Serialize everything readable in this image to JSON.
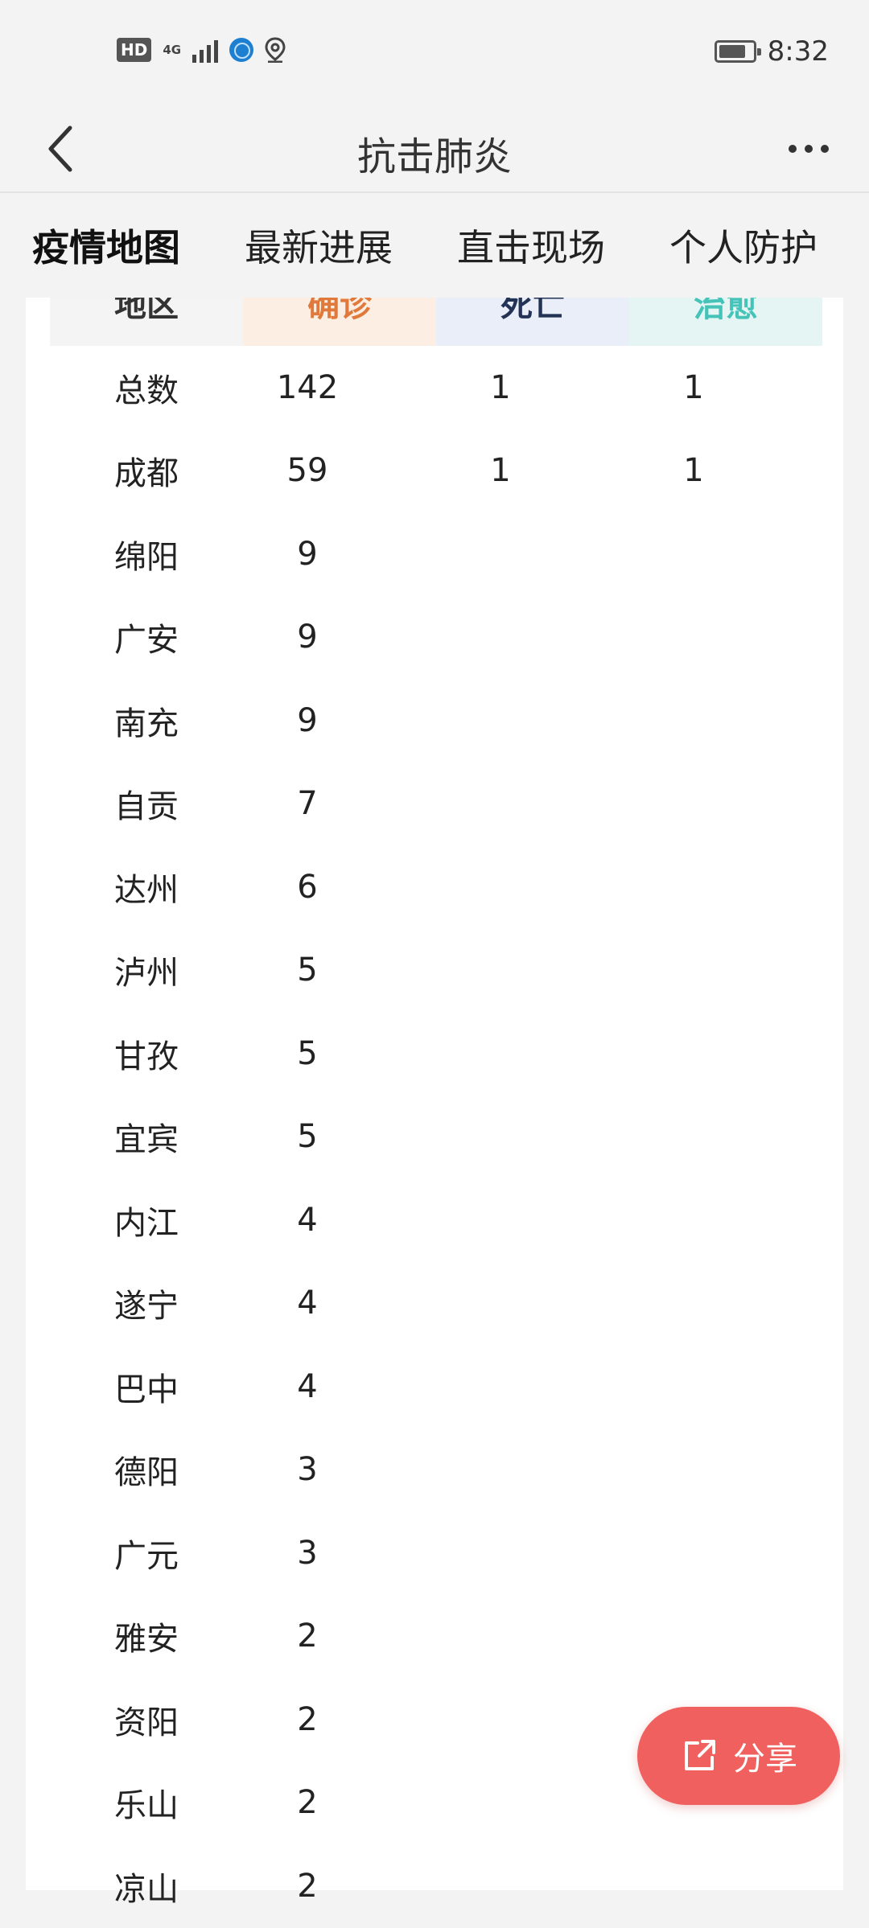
{
  "status_bar": {
    "hd": "HD",
    "network": "4G",
    "time": "8:32"
  },
  "header": {
    "title": "抗击肺炎"
  },
  "tabs": [
    {
      "label": "疫情地图",
      "active": true
    },
    {
      "label": "最新进展",
      "active": false
    },
    {
      "label": "直击现场",
      "active": false
    },
    {
      "label": "个人防护",
      "active": false
    }
  ],
  "table": {
    "columns": {
      "region": "地区",
      "confirmed": "确诊",
      "death": "死亡",
      "cured": "治愈"
    },
    "rows": [
      {
        "region": "总数",
        "confirmed": "142",
        "death": "1",
        "cured": "1"
      },
      {
        "region": "成都",
        "confirmed": "59",
        "death": "1",
        "cured": "1"
      },
      {
        "region": "绵阳",
        "confirmed": "9",
        "death": "",
        "cured": ""
      },
      {
        "region": "广安",
        "confirmed": "9",
        "death": "",
        "cured": ""
      },
      {
        "region": "南充",
        "confirmed": "9",
        "death": "",
        "cured": ""
      },
      {
        "region": "自贡",
        "confirmed": "7",
        "death": "",
        "cured": ""
      },
      {
        "region": "达州",
        "confirmed": "6",
        "death": "",
        "cured": ""
      },
      {
        "region": "泸州",
        "confirmed": "5",
        "death": "",
        "cured": ""
      },
      {
        "region": "甘孜",
        "confirmed": "5",
        "death": "",
        "cured": ""
      },
      {
        "region": "宜宾",
        "confirmed": "5",
        "death": "",
        "cured": ""
      },
      {
        "region": "内江",
        "confirmed": "4",
        "death": "",
        "cured": ""
      },
      {
        "region": "遂宁",
        "confirmed": "4",
        "death": "",
        "cured": ""
      },
      {
        "region": "巴中",
        "confirmed": "4",
        "death": "",
        "cured": ""
      },
      {
        "region": "德阳",
        "confirmed": "3",
        "death": "",
        "cured": ""
      },
      {
        "region": "广元",
        "confirmed": "3",
        "death": "",
        "cured": ""
      },
      {
        "region": "雅安",
        "confirmed": "2",
        "death": "",
        "cured": ""
      },
      {
        "region": "资阳",
        "confirmed": "2",
        "death": "",
        "cured": ""
      },
      {
        "region": "乐山",
        "confirmed": "2",
        "death": "",
        "cured": ""
      },
      {
        "region": "凉山",
        "confirmed": "2",
        "death": "",
        "cured": ""
      }
    ]
  },
  "share": {
    "label": "分享"
  },
  "colors": {
    "accent": "#e25a5a",
    "confirmed": "#e07a3c",
    "death": "#223355",
    "cured": "#45c3b8",
    "share_bg": "#f0605f"
  }
}
